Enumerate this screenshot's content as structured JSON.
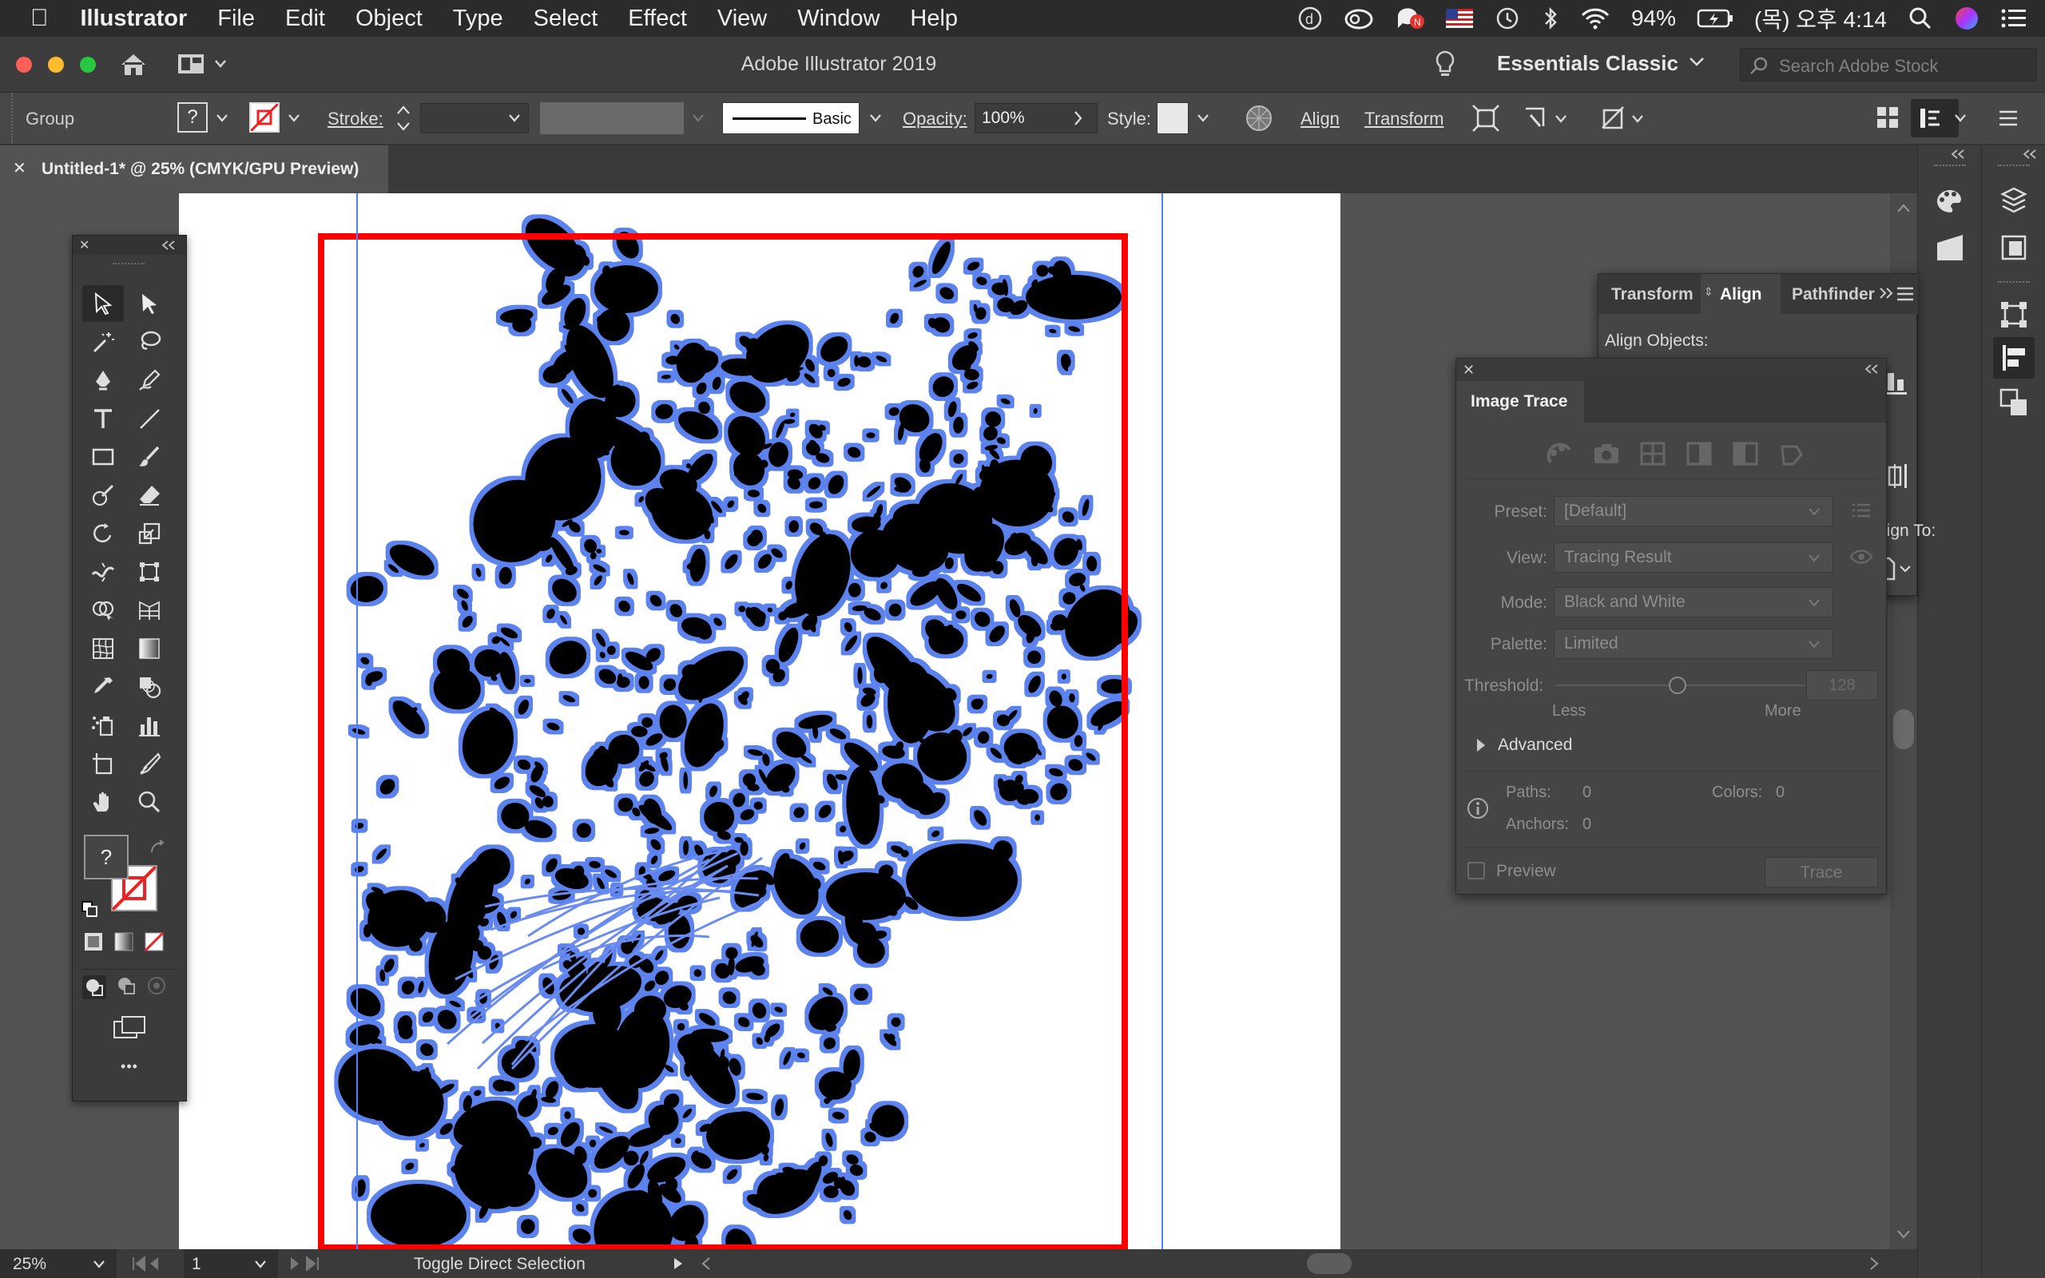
{
  "menubar": {
    "app_name": "Illustrator",
    "items": [
      "File",
      "Edit",
      "Object",
      "Type",
      "Select",
      "Effect",
      "View",
      "Window",
      "Help"
    ],
    "battery": "94%",
    "clock": "(목) 오후 4:14"
  },
  "titlebar": {
    "title": "Adobe Illustrator 2019",
    "workspace": "Essentials Classic",
    "search_placeholder": "Search Adobe Stock"
  },
  "control": {
    "selection_type": "Group",
    "fill_value": "?",
    "stroke_label": "Stroke:",
    "brush_label": "Basic",
    "opacity_label": "Opacity:",
    "opacity_value": "100%",
    "style_label": "Style:",
    "align_link": "Align",
    "transform_link": "Transform"
  },
  "document": {
    "tab_title": "Untitled-1* @ 25% (CMYK/GPU Preview)",
    "close_glyph": "✕"
  },
  "status": {
    "zoom": "25%",
    "artboard_number": "1",
    "tool_hint": "Toggle Direct Selection"
  },
  "toolbox": {
    "fill_unknown": "?",
    "more_glyph": "•••"
  },
  "align_panel": {
    "tabs": [
      "Transform",
      "Align",
      "Pathfinder"
    ],
    "active_tab": "Align",
    "align_objects_label": "Align Objects:",
    "align_to_label": "Align To:"
  },
  "image_trace": {
    "title": "Image Trace",
    "preset_label": "Preset:",
    "preset_value": "[Default]",
    "view_label": "View:",
    "view_value": "Tracing Result",
    "mode_label": "Mode:",
    "mode_value": "Black and White",
    "palette_label": "Palette:",
    "palette_value": "Limited",
    "threshold_label": "Threshold:",
    "threshold_value": "128",
    "less_label": "Less",
    "more_label": "More",
    "advanced_label": "Advanced",
    "paths_label": "Paths:",
    "paths_value": "0",
    "colors_label": "Colors:",
    "colors_value": "0",
    "anchors_label": "Anchors:",
    "anchors_value": "0",
    "preview_label": "Preview",
    "trace_button": "Trace"
  },
  "colors": {
    "selection_blue": "#5b82ee",
    "artboard_red": "#ff0000",
    "ui_dark": "#3b3b3b"
  }
}
